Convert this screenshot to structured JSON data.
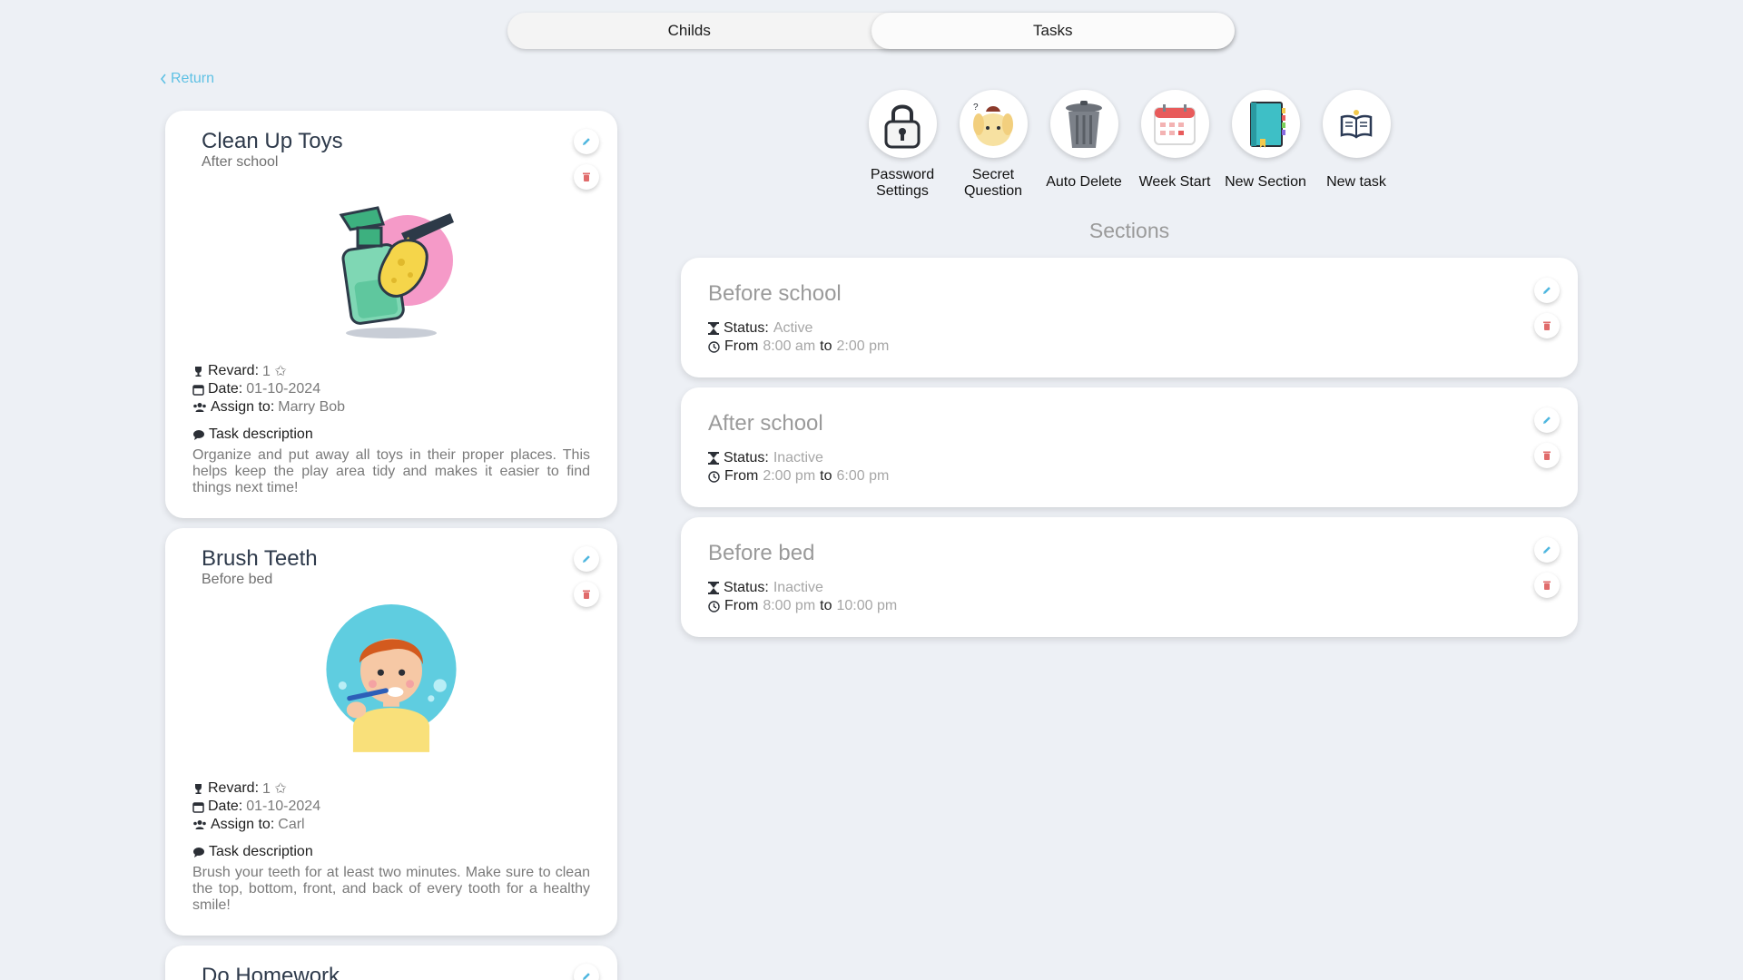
{
  "tabs": [
    {
      "label": "Childs",
      "active": false
    },
    {
      "label": "Tasks",
      "active": true
    }
  ],
  "return_label": "Return",
  "actions": [
    {
      "label": "Password Settings",
      "icon": "padlock-icon"
    },
    {
      "label": "Secret Question",
      "icon": "puppy-icon"
    },
    {
      "label": "Auto Delete",
      "icon": "trash-can-icon"
    },
    {
      "label": "Week Start",
      "icon": "calendar-icon"
    },
    {
      "label": "New Section",
      "icon": "notebook-icon"
    },
    {
      "label": "New task",
      "icon": "open-book-icon"
    }
  ],
  "sections_title": "Sections",
  "sections": [
    {
      "name": "Before school",
      "status_label": "Status:",
      "status": "Active",
      "from_label": "From",
      "from": "8:00 am",
      "to_label": "to",
      "to": "2:00 pm"
    },
    {
      "name": "After school",
      "status_label": "Status:",
      "status": "Inactive",
      "from_label": "From",
      "from": "2:00 pm",
      "to_label": "to",
      "to": "6:00 pm"
    },
    {
      "name": "Before bed",
      "status_label": "Status:",
      "status": "Inactive",
      "from_label": "From",
      "from": "8:00 pm",
      "to_label": "to",
      "to": "10:00 pm"
    }
  ],
  "tasks": [
    {
      "title": "Clean Up Toys",
      "section": "After school",
      "reward_label": "Revard:",
      "reward": "1 ✩",
      "date_label": "Date:",
      "date": "01-10-2024",
      "assign_label": "Assign to:",
      "assign": "Marry Bob",
      "desc_label": "Task description",
      "description": "Organize and put away all toys in their proper places. This helps keep the play area tidy and makes it easier to find things next time!"
    },
    {
      "title": "Brush Teeth",
      "section": "Before bed",
      "reward_label": "Revard:",
      "reward": "1 ✩",
      "date_label": "Date:",
      "date": "01-10-2024",
      "assign_label": "Assign to:",
      "assign": "Carl",
      "desc_label": "Task description",
      "description": "Brush your teeth for at least two minutes. Make sure to clean the top, bottom, front, and back of every tooth for a healthy smile!"
    },
    {
      "title": "Do Homework"
    }
  ],
  "colors": {
    "background": "#edf0f5",
    "accent": "#5fc1e4",
    "delete": "#e06b6b",
    "muted": "#9a9a9a"
  }
}
